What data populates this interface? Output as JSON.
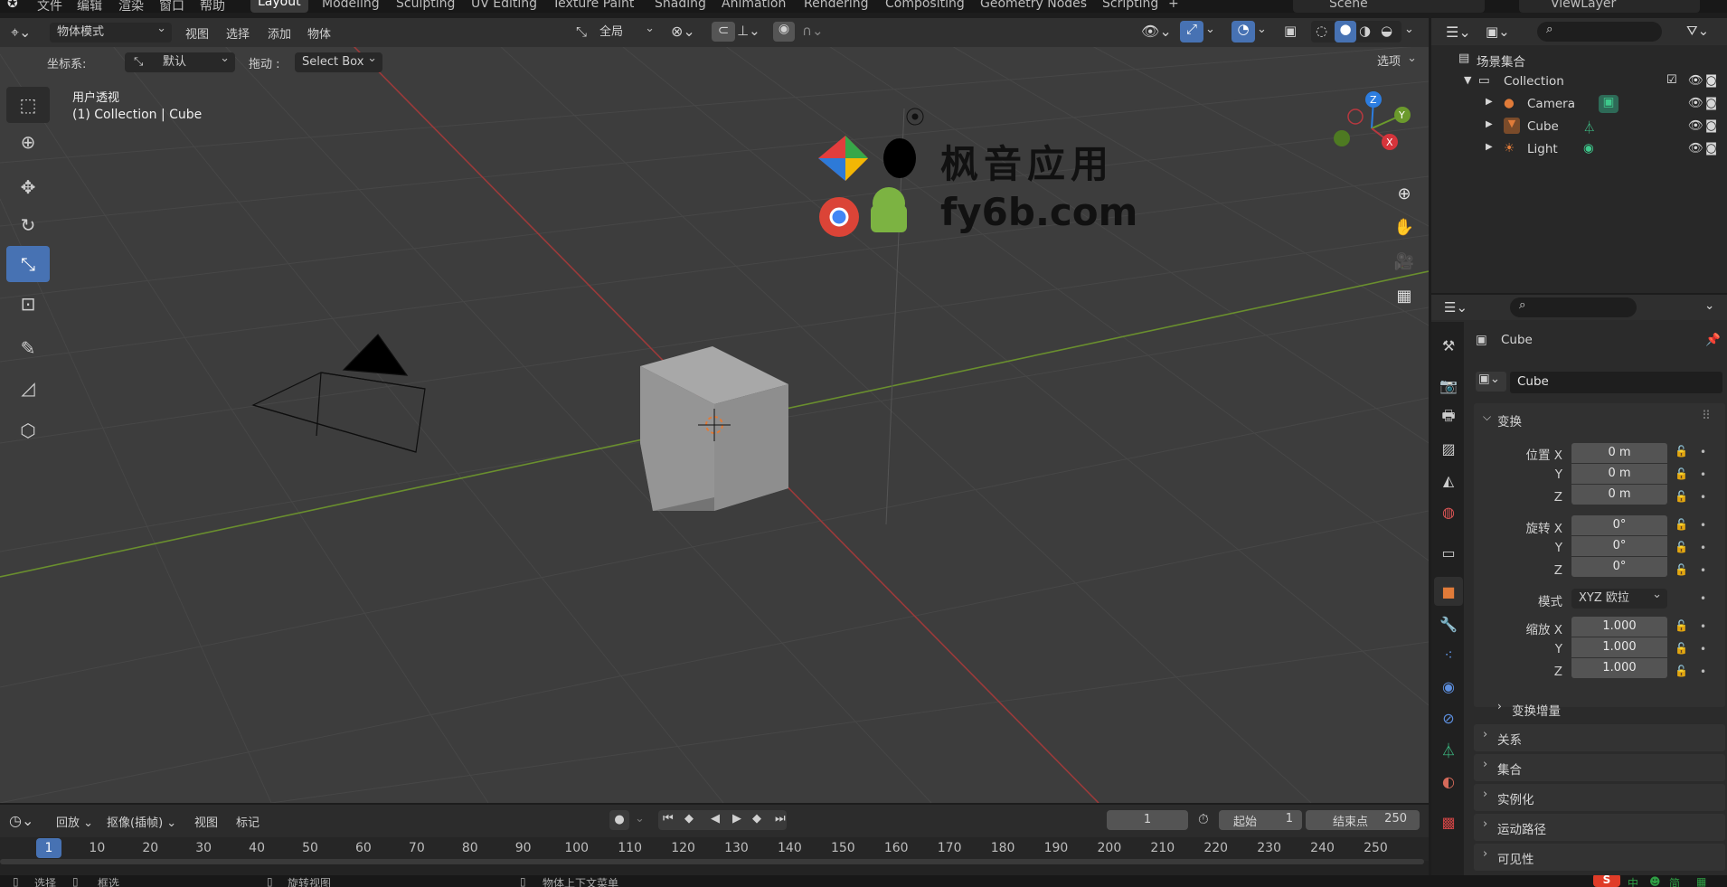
{
  "menubar": {
    "items": [
      "文件",
      "编辑",
      "渲染",
      "窗口",
      "帮助"
    ],
    "workspaces": [
      "Layout",
      "Modeling",
      "Sculpting",
      "UV Editing",
      "Texture Paint",
      "Shading",
      "Animation",
      "Rendering",
      "Compositing",
      "Geometry Nodes",
      "Scripting"
    ],
    "add_tab": "+",
    "scene": "Scene",
    "view_layer": "ViewLayer"
  },
  "viewport_header": {
    "mode": "物体模式",
    "menus": [
      "视图",
      "选择",
      "添加",
      "物体"
    ],
    "orientation": "全局"
  },
  "tool_settings": {
    "coord_label": "坐标系:",
    "coord_value": "默认",
    "drag_label": "拖动 :",
    "drag_value": "Select Box",
    "options": "选项"
  },
  "viewport": {
    "view_name": "用户透视",
    "context": "(1) Collection | Cube",
    "gizmo_axes": {
      "x": "X",
      "y": "Y",
      "z": "Z"
    },
    "watermark_title": "枫音应用",
    "watermark_url": "fy6b.com"
  },
  "outliner": {
    "root": "场景集合",
    "collection": "Collection",
    "objects": [
      "Camera",
      "Cube",
      "Light"
    ]
  },
  "properties": {
    "object_name": "Cube",
    "data_name": "Cube",
    "transform_title": "变换",
    "location_label": "位置 X",
    "rotation_label": "旋转 X",
    "scale_label": "缩放 X",
    "y_label": "Y",
    "z_label": "Z",
    "location": [
      "0 m",
      "0 m",
      "0 m"
    ],
    "rotation": [
      "0°",
      "0°",
      "0°"
    ],
    "mode_label": "模式",
    "mode_value": "XYZ 欧拉",
    "scale": [
      "1.000",
      "1.000",
      "1.000"
    ],
    "delta_transform": "变换增量",
    "sections": [
      "关系",
      "集合",
      "实例化",
      "运动路径",
      "可见性"
    ]
  },
  "timeline": {
    "playback": "回放",
    "keying": "抠像(插帧)",
    "view": "视图",
    "marker": "标记",
    "current_frame": "1",
    "start_label": "起始",
    "start_value": "1",
    "end_label": "结束点",
    "end_value": "250",
    "ruler_current": "1",
    "ruler_ticks": [
      "10",
      "20",
      "30",
      "40",
      "50",
      "60",
      "70",
      "80",
      "90",
      "100",
      "110",
      "120",
      "130",
      "140",
      "150",
      "160",
      "170",
      "180",
      "190",
      "200",
      "210",
      "220",
      "230",
      "240",
      "250"
    ]
  },
  "statusbar": {
    "select": "选择",
    "box_select": "框选",
    "rotate_view": "旋转视图",
    "context_menu": "物体上下文菜单",
    "ime": [
      "中",
      "简"
    ]
  },
  "colors": {
    "active_blue": "#4772b3",
    "x_axis": "#b8383f",
    "y_axis": "#6b9a2c",
    "z_axis": "#2c7de0",
    "object_orange": "#e07b39",
    "mesh_green": "#3ec98c"
  }
}
